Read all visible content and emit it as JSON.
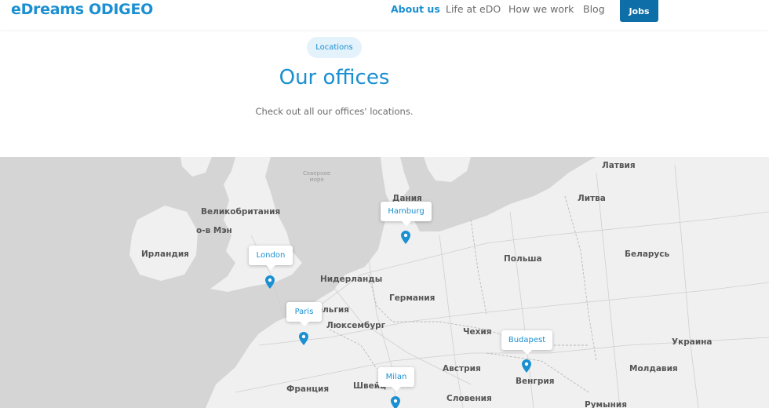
{
  "header": {
    "logo": "eDreams ODIGEO",
    "nav": [
      "About us",
      "Life at eDO",
      "How we work",
      "Blog"
    ],
    "jobs_label": "Jobs"
  },
  "hero": {
    "badge": "Locations",
    "title": "Our offices",
    "subtitle": "Check out all our offices' locations."
  },
  "map": {
    "country_labels": [
      "Латвия",
      "Литва",
      "Дания",
      "Великобритания",
      "о-в Мэн",
      "Ирландия",
      "Беларусь",
      "Польша",
      "Нидерланды",
      "Германия",
      "ельгия",
      "Люксембург",
      "Чехия",
      "Украина",
      "Австрия",
      "Молдавия",
      "Венгрия",
      "Франция",
      "Швейц",
      "Словения",
      "Румыния"
    ],
    "sea_label": [
      "Северное",
      "море"
    ],
    "offices": [
      "London",
      "Hamburg",
      "Paris",
      "Budapest",
      "Milan"
    ],
    "pin_color": "#1a8fd1"
  }
}
